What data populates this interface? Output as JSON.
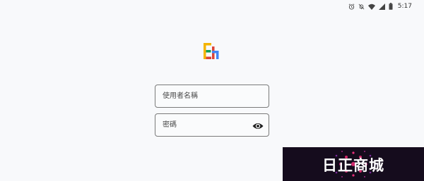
{
  "status_bar": {
    "time": "5:17",
    "icons": [
      "alarm-icon",
      "bell-off-icon",
      "wifi-icon",
      "signal-icon",
      "battery-icon"
    ]
  },
  "app": {
    "logo_icon": "app-logo-icon"
  },
  "login": {
    "username_placeholder": "使用者名稱",
    "username_value": "",
    "password_placeholder": "密碼",
    "password_value": ""
  },
  "watermark": {
    "text": "日正商城"
  },
  "colors": {
    "background": "#f8f9fb",
    "field_border": "#7a7a7a",
    "logo_yellow": "#f4b400",
    "logo_green": "#0f9d58",
    "logo_red": "#db4437",
    "logo_blue": "#4285f4",
    "watermark_bg": "#150c1d",
    "watermark_accent": "#e8307a"
  }
}
